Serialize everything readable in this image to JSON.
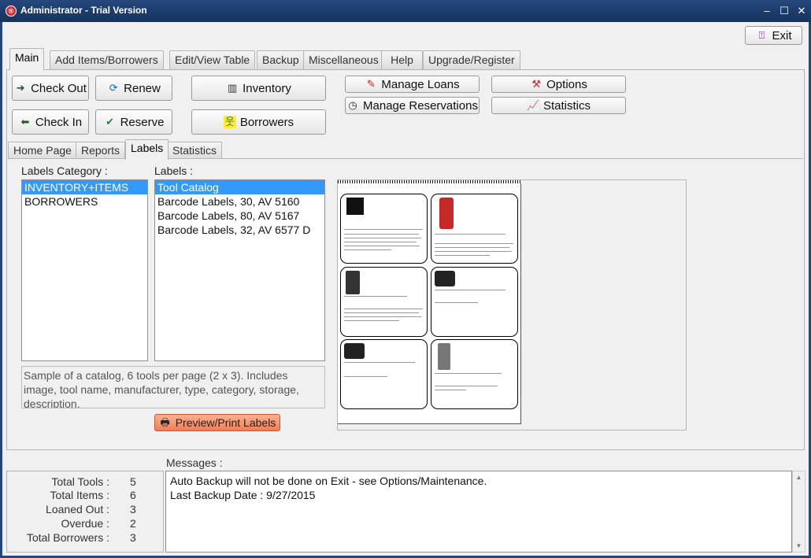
{
  "window": {
    "title": "Administrator - Trial Version"
  },
  "exit_label": "Exit",
  "main_tabs": [
    {
      "label": "Main"
    },
    {
      "label": "Add Items/Borrowers"
    },
    {
      "label": "Edit/View Table"
    },
    {
      "label": "Backup"
    },
    {
      "label": "Miscellaneous"
    },
    {
      "label": "Help"
    },
    {
      "label": "Upgrade/Register"
    }
  ],
  "toolbar": {
    "check_out": "Check Out",
    "renew": "Renew",
    "inventory": "Inventory",
    "check_in": "Check In",
    "reserve": "Reserve",
    "borrowers": "Borrowers",
    "manage_loans": "Manage Loans",
    "manage_reservations": "Manage Reservations",
    "options": "Options",
    "statistics": "Statistics"
  },
  "sub_tabs": [
    {
      "label": "Home Page"
    },
    {
      "label": "Reports"
    },
    {
      "label": "Labels"
    },
    {
      "label": "Statistics"
    }
  ],
  "labels_page": {
    "category_heading": "Labels Category :",
    "labels_heading": "Labels :",
    "categories": [
      "INVENTORY+ITEMS",
      "BORROWERS"
    ],
    "labels": [
      "Tool Catalog",
      "Barcode Labels, 30, AV 5160",
      "Barcode Labels, 80, AV 5167",
      "Barcode Labels, 32, AV 6577 D"
    ],
    "description": "Sample of a catalog, 6 tools per page (2 x 3). Includes image, tool name, manufacturer, type, category, storage, description.",
    "preview_button": "Preview/Print Labels"
  },
  "messages": {
    "heading": "Messages :",
    "lines": [
      "Auto Backup will not be done on Exit - see Options/Maintenance.",
      "Last Backup Date : 9/27/2015"
    ]
  },
  "stats": [
    {
      "name": "Total Tools :",
      "value": "5"
    },
    {
      "name": "Total Items :",
      "value": "6"
    },
    {
      "name": "Loaned Out :",
      "value": "3"
    },
    {
      "name": "Overdue :",
      "value": "2"
    },
    {
      "name": "Total Borrowers :",
      "value": "3"
    }
  ],
  "colors": {
    "titlebar": "#24467c",
    "selection": "#3399ff",
    "preview_button": "#f27d53"
  }
}
